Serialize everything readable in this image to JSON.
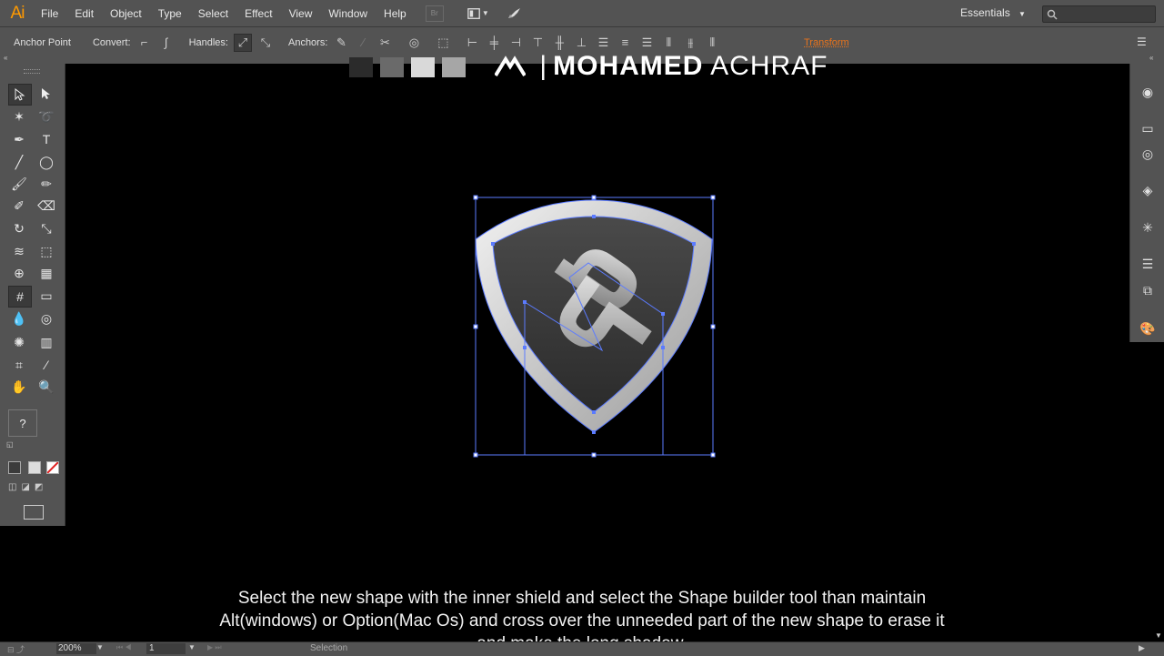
{
  "app": {
    "logo": "Ai"
  },
  "menu": [
    "File",
    "Edit",
    "Object",
    "Type",
    "Select",
    "Effect",
    "View",
    "Window",
    "Help"
  ],
  "workspace": "Essentials",
  "control_bar": {
    "tool_label": "Anchor Point",
    "convert_label": "Convert:",
    "handles_label": "Handles:",
    "anchors_label": "Anchors:",
    "transform_link": "Transform"
  },
  "canvas": {
    "brand_bold": "MOHAMED",
    "brand_light": "ACHRAF",
    "brand_mark": "— |",
    "swatch_colors": [
      "#2b2b2b",
      "#6a6a6a",
      "#d9d9d9",
      "#a6a6a6"
    ],
    "subtitle": "Select the new shape with the inner shield and select the Shape builder tool than maintain Alt(windows) or Option(Mac Os) and cross over the unneeded part of the new shape to erase it and make the long shadow."
  },
  "status": {
    "zoom": "200%",
    "page": "1",
    "tool": "Selection"
  },
  "colors": {
    "accent": "#ff9a00",
    "selection": "#5b7bff",
    "ui_bg": "#535353"
  }
}
